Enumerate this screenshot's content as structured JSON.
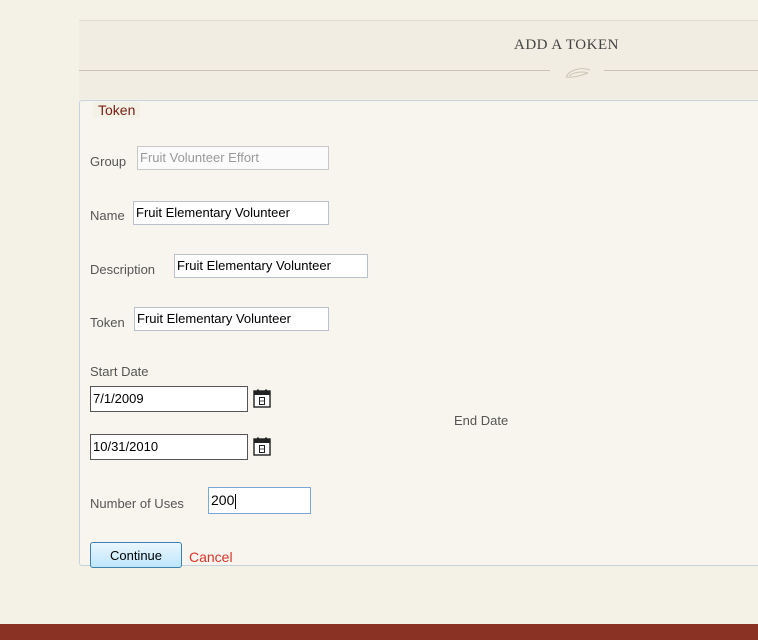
{
  "page": {
    "title": "ADD A TOKEN"
  },
  "form": {
    "legend": "Token",
    "group": {
      "label": "Group",
      "value": "Fruit Volunteer Effort"
    },
    "name": {
      "label": "Name",
      "value": "Fruit Elementary Volunteer"
    },
    "description": {
      "label": "Description",
      "value": "Fruit Elementary Volunteer"
    },
    "token": {
      "label": "Token",
      "value": "Fruit Elementary Volunteer"
    },
    "start_date": {
      "label": "Start Date",
      "value": "7/1/2009"
    },
    "end_date": {
      "label": "End Date",
      "value": "10/31/2010"
    },
    "uses": {
      "label": "Number of Uses",
      "value": "200"
    }
  },
  "actions": {
    "continue_label": "Continue",
    "cancel_label": "Cancel"
  },
  "colors": {
    "background": "#f4f1e7",
    "footer": "#8a3324",
    "legend": "#7a1e14",
    "cancel_link": "#d8362a"
  },
  "icons": {
    "calendar": "calendar-icon",
    "flourish": "flourish-icon"
  }
}
